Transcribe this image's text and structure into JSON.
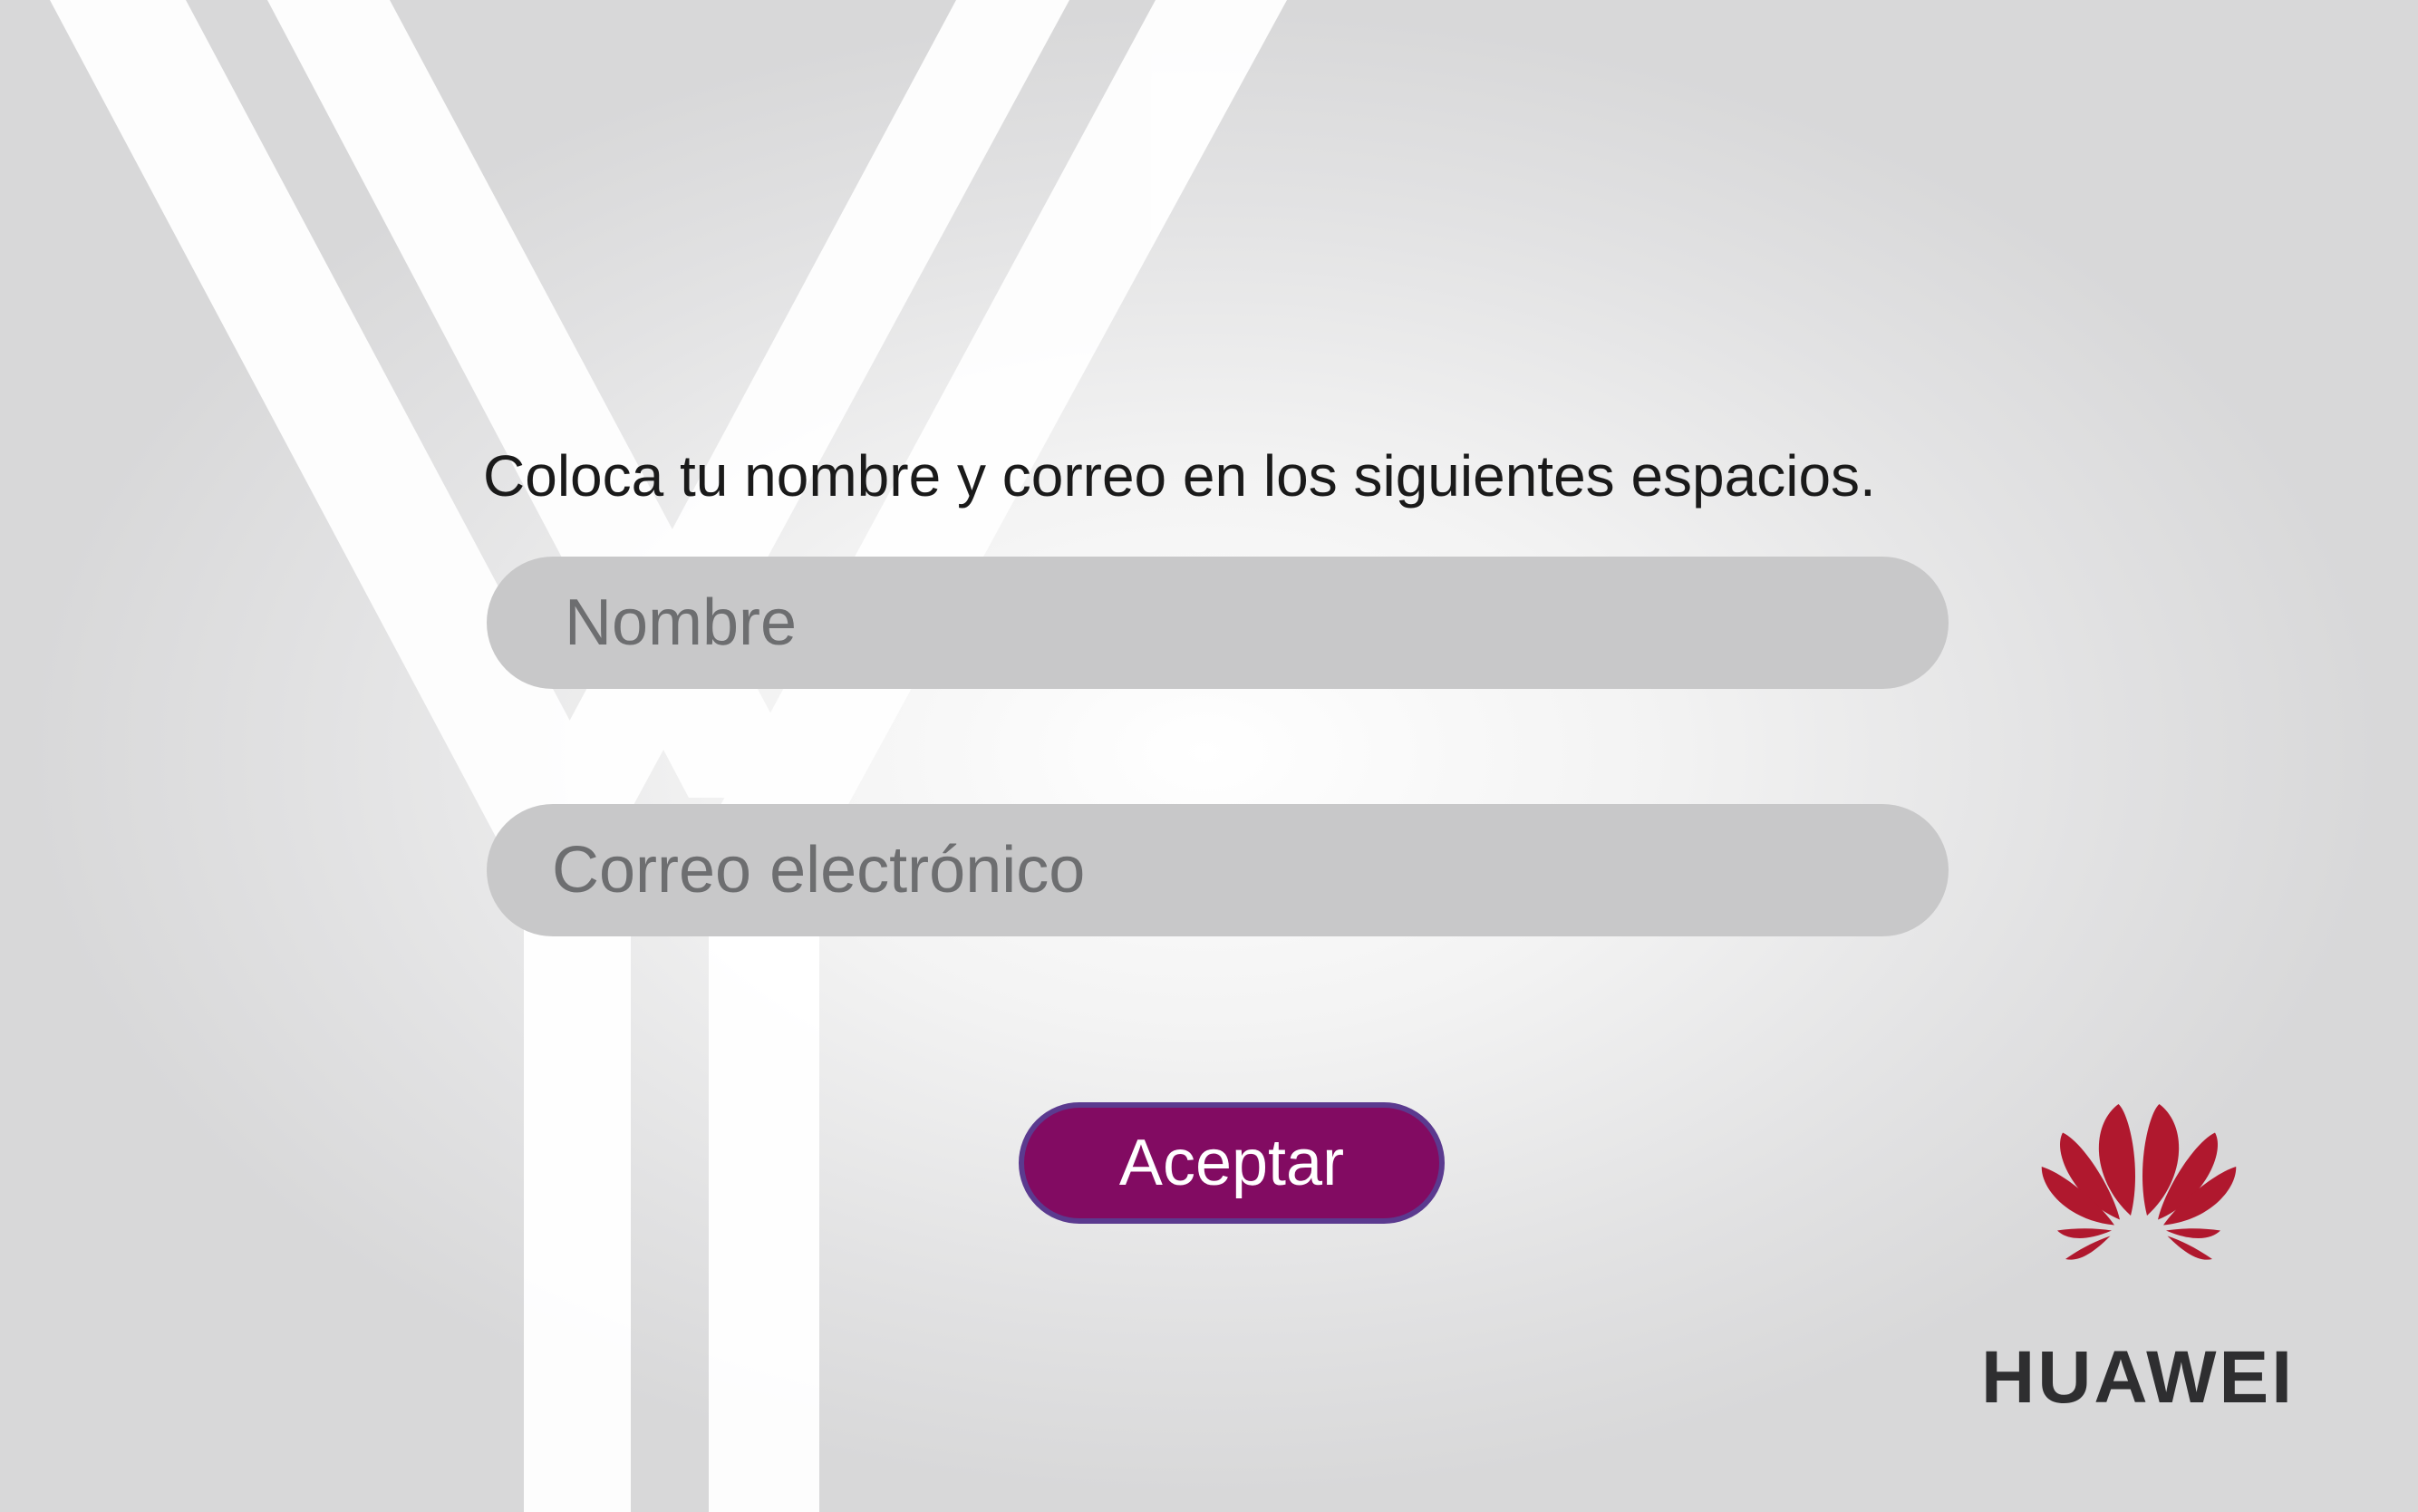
{
  "form": {
    "instruction": "Coloca tu nombre y correo en los siguientes espacios.",
    "name_placeholder": "Nombre",
    "email_placeholder": "Correo electrónico",
    "submit_label": "Aceptar"
  },
  "brand": {
    "name": "HUAWEI",
    "logo_icon": "huawei-petals-icon",
    "logo_color": "#b0182e",
    "button_color": "#820b62",
    "button_border_color": "#5b3a8f",
    "field_color": "#c8c8c9"
  }
}
